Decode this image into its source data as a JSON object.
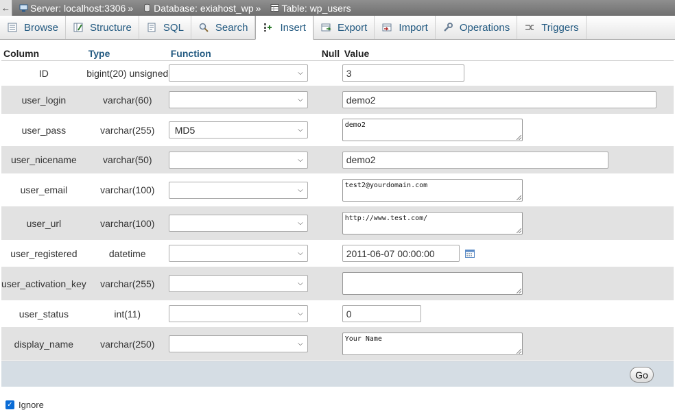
{
  "breadcrumb": {
    "server": "Server: localhost:3306",
    "database": "Database: exiahost_wp",
    "table": "Table: wp_users",
    "sep1": "»",
    "sep2": "»"
  },
  "tabs": [
    {
      "label": "Browse",
      "icon": "browse-icon"
    },
    {
      "label": "Structure",
      "icon": "structure-icon"
    },
    {
      "label": "SQL",
      "icon": "sql-icon"
    },
    {
      "label": "Search",
      "icon": "search-icon"
    },
    {
      "label": "Insert",
      "icon": "insert-icon",
      "active": true
    },
    {
      "label": "Export",
      "icon": "export-icon"
    },
    {
      "label": "Import",
      "icon": "import-icon"
    },
    {
      "label": "Operations",
      "icon": "wrench-icon"
    },
    {
      "label": "Triggers",
      "icon": "triggers-icon"
    }
  ],
  "headers": {
    "column": "Column",
    "type": "Type",
    "function": "Function",
    "null": "Null",
    "value": "Value"
  },
  "rows": [
    {
      "column": "ID",
      "type": "bigint(20) unsigned",
      "function": "",
      "value": "3"
    },
    {
      "column": "user_login",
      "type": "varchar(60)",
      "function": "",
      "value": "demo2"
    },
    {
      "column": "user_pass",
      "type": "varchar(255)",
      "function": "MD5",
      "value": "demo2"
    },
    {
      "column": "user_nicename",
      "type": "varchar(50)",
      "function": "",
      "value": "demo2"
    },
    {
      "column": "user_email",
      "type": "varchar(100)",
      "function": "",
      "value": "test2@yourdomain.com"
    },
    {
      "column": "user_url",
      "type": "varchar(100)",
      "function": "",
      "value": "http://www.test.com/"
    },
    {
      "column": "user_registered",
      "type": "datetime",
      "function": "",
      "value": "2011-06-07 00:00:00"
    },
    {
      "column": "user_activation_key",
      "type": "varchar(255)",
      "function": "",
      "value": ""
    },
    {
      "column": "user_status",
      "type": "int(11)",
      "function": "",
      "value": "0"
    },
    {
      "column": "display_name",
      "type": "varchar(250)",
      "function": "",
      "value": "Your Name"
    }
  ],
  "footer": {
    "go_label": "Go",
    "ignore_label": "Ignore"
  },
  "colors": {
    "link": "#235a81",
    "even_row": "#e2e2e2",
    "footer_bg": "#d5dde4",
    "topbar": "#7f7f7f"
  }
}
